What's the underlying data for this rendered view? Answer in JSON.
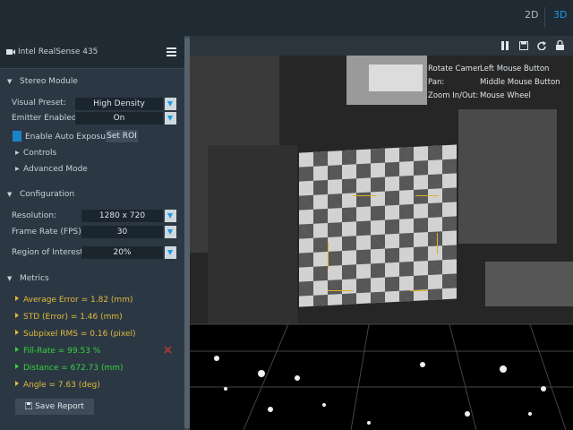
{
  "view_toggle": {
    "label_2d": "2D",
    "label_3d": "3D"
  },
  "device": {
    "name": "Intel RealSense 435"
  },
  "stereo": {
    "section_title": "Stereo Module",
    "visual_preset_label": "Visual Preset:",
    "visual_preset_value": "High Density",
    "emitter_label": "Emitter Enabled:",
    "emitter_value": "On",
    "auto_exposure_label": "Enable Auto Exposure",
    "set_roi_label": "Set ROI",
    "controls_label": "Controls",
    "advanced_label": "Advanced Mode"
  },
  "configuration": {
    "section_title": "Configuration",
    "resolution_label": "Resolution:",
    "resolution_value": "1280 x 720",
    "fps_label": "Frame Rate (FPS):",
    "fps_value": "30",
    "roi_label": "Region of Interest:",
    "roi_value": "20%"
  },
  "metrics": {
    "section_title": "Metrics",
    "items": [
      {
        "label": "Average Error = 1.82 (mm)",
        "color": "#e3b93b"
      },
      {
        "label": "STD (Error) = 1.46 (mm)",
        "color": "#e3b93b"
      },
      {
        "label": "Subpixel RMS = 0.16 (pixel)",
        "color": "#e3b93b"
      },
      {
        "label": "Fill-Rate = 99.53 %",
        "color": "#35d23a"
      },
      {
        "label": "Distance = 672.73 (mm)",
        "color": "#35d23a"
      },
      {
        "label": "Angle = 7.63 (deg)",
        "color": "#e3b93b"
      }
    ],
    "save_label": "Save Report"
  },
  "viewport_help": [
    {
      "action": "Rotate Camer",
      "binding": "Left Mouse Button"
    },
    {
      "action": "Pan:",
      "binding": "Middle Mouse Button"
    },
    {
      "action": "Zoom In/Out:",
      "binding": "Mouse Wheel"
    }
  ],
  "colors": {
    "accent": "#1b9ce5",
    "metric_warn": "#e3b93b",
    "metric_ok": "#35d23a",
    "roi": "#e0b020"
  }
}
